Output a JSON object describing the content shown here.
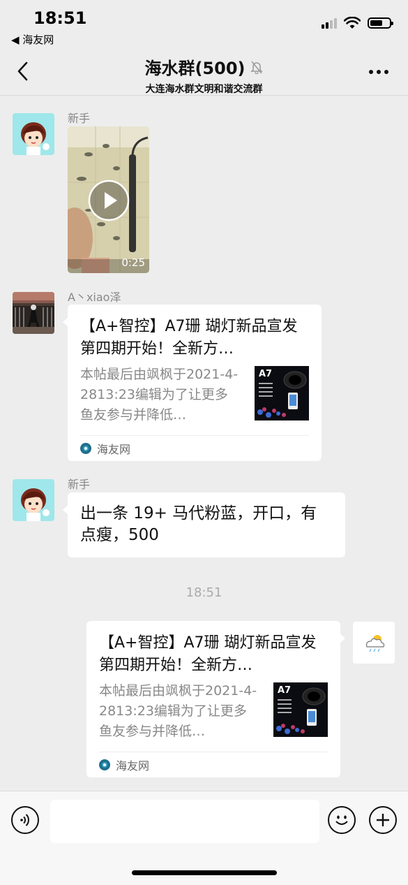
{
  "status_bar": {
    "time": "18:51",
    "back_app": "◀ 海友网"
  },
  "nav": {
    "title": "海水群(500)",
    "subtitle": "大连海水群文明和谐交流群"
  },
  "messages": [
    {
      "sender": "新手",
      "type": "video",
      "duration": "0:25"
    },
    {
      "sender": "A丶xiao泽",
      "type": "link",
      "title": "【A+智控】A7珊 瑚灯新品宣发  第四期开始！全新方…",
      "desc": "本帖最后由飒枫于2021-4-2813:23编辑为了让更多鱼友参与并降低…",
      "thumb_label": "A7",
      "source": "海友网"
    },
    {
      "sender": "新手",
      "type": "text",
      "text": "出一条 19+ 马代粉蓝，开口，有点瘦，500"
    },
    {
      "sender": "",
      "type": "link",
      "outgoing": true,
      "title": "【A+智控】A7珊 瑚灯新品宣发  第四期开始！全新方…",
      "desc": "本帖最后由飒枫于2021-4-2813:23编辑为了让更多鱼友参与并降低…",
      "thumb_label": "A7",
      "source": "海友网"
    }
  ],
  "time_divider": "18:51",
  "input": {
    "placeholder": ""
  }
}
